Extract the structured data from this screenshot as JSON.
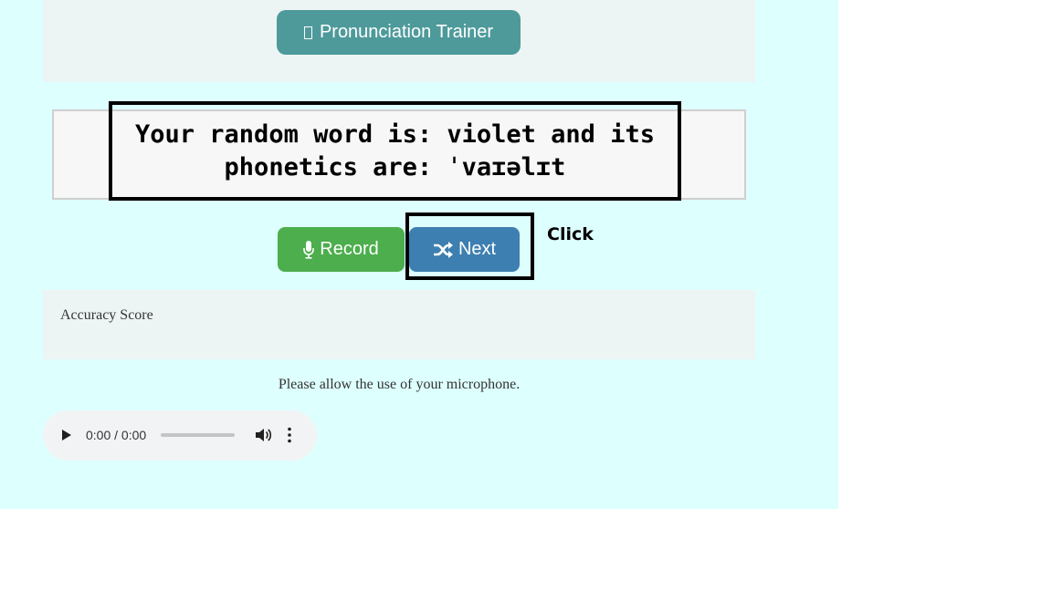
{
  "header": {
    "title_icon": "missing-glyph-icon",
    "title_label": "Pronunciation Trainer"
  },
  "word_panel": {
    "line1": "Your random word is: violet and its",
    "line2": "phonetics are: ˈvaɪəlɪt"
  },
  "actions": {
    "record_label": "Record",
    "record_icon": "microphone-icon",
    "next_label": "Next",
    "next_icon": "shuffle-icon"
  },
  "annotation": {
    "click_label": "Click"
  },
  "score": {
    "label": "Accuracy Score"
  },
  "notice": {
    "text": "Please allow the use of your microphone."
  },
  "audio_player": {
    "time": "0:00 / 0:00",
    "progress": 0
  },
  "colors": {
    "page_bg": "#ddfffe",
    "title_button": "#4e9a9b",
    "record_button": "#4cae4c",
    "next_button": "#3d7fb0"
  }
}
